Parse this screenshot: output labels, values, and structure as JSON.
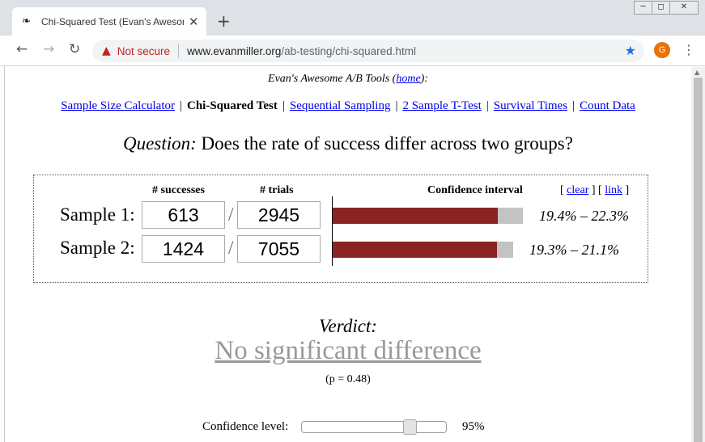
{
  "browser": {
    "tab_title": "Chi-Squared Test (Evan's Awesom",
    "favicon": "leaf-glyph-icon",
    "tab_close": "✕",
    "new_tab": "+",
    "security_label": "Not secure",
    "url_host": "www.evanmiller.org",
    "url_path": "/ab-testing/chi-squared.html",
    "profile_initial": "G",
    "colors": {
      "profile": "#e8710a",
      "warning": "#c5221f",
      "star": "#1a73e8"
    }
  },
  "header": {
    "prefix": "Evan's Awesome A/B Tools (",
    "home_link": "home",
    "suffix": "):"
  },
  "nav": {
    "items": [
      {
        "label": "Sample Size Calculator",
        "current": false
      },
      {
        "label": "Chi-Squared Test",
        "current": true
      },
      {
        "label": "Sequential Sampling",
        "current": false
      },
      {
        "label": "2 Sample T-Test",
        "current": false
      },
      {
        "label": "Survival Times",
        "current": false
      },
      {
        "label": "Count Data",
        "current": false
      }
    ],
    "separator": "|"
  },
  "question": {
    "label": "Question:",
    "text": " Does the rate of success differ across two groups?"
  },
  "calculator": {
    "col_successes": "# successes",
    "col_trials": "# trials",
    "col_ci": "Confidence interval",
    "link_clear": "clear",
    "link_link": "link",
    "slash": "/",
    "samples": [
      {
        "label": "Sample 1:",
        "successes": "613",
        "trials": "2945",
        "ci_text": "19.4% – 22.3%",
        "bar_fill_fraction": 0.87
      },
      {
        "label": "Sample 2:",
        "successes": "1424",
        "trials": "7055",
        "ci_text": "19.3% – 21.1%",
        "bar_fill_fraction": 0.91
      }
    ],
    "colors": {
      "bar_fill": "#8b2323",
      "bar_bg": "#c3c3c3"
    }
  },
  "result": {
    "verdict_label": "Verdict:",
    "verdict": "No significant difference",
    "p_value": "(p = 0.48)"
  },
  "confidence": {
    "label": "Confidence level:",
    "value": "95%",
    "slider_fraction": 0.77
  }
}
